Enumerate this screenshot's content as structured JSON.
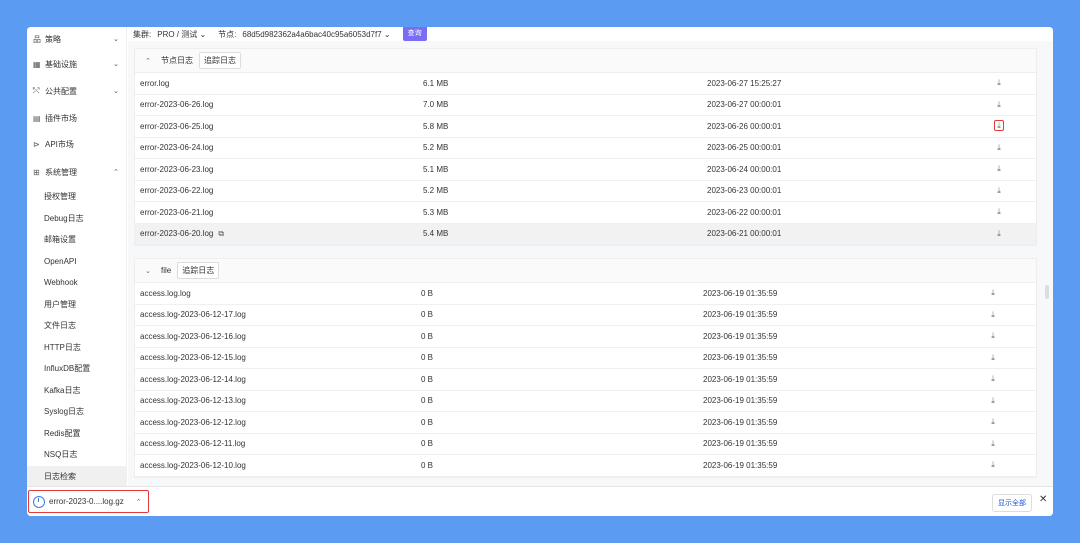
{
  "sidebar": {
    "items": [
      {
        "icon": "strategy-icon",
        "glyph": "品",
        "label": "策略",
        "chevron": "⌄"
      },
      {
        "icon": "grid-icon",
        "glyph": "▦",
        "label": "基础设施",
        "chevron": "⌄"
      },
      {
        "icon": "share-icon",
        "glyph": "⤲",
        "label": "公共配置",
        "chevron": "⌄"
      },
      {
        "icon": "store-icon",
        "glyph": "▤",
        "label": "插件市场",
        "chevron": ""
      },
      {
        "icon": "api-icon",
        "glyph": "⊳",
        "label": "API市场",
        "chevron": ""
      },
      {
        "icon": "apps-icon",
        "glyph": "⊞",
        "label": "系统管理",
        "chevron": "⌃"
      }
    ],
    "sub_items": [
      "授权管理",
      "Debug日志",
      "邮箱设置",
      "OpenAPI",
      "Webhook",
      "用户管理",
      "文件日志",
      "HTTP日志",
      "InfluxDB配置",
      "Kafka日志",
      "Syslog日志",
      "Redis配置",
      "NSQ日志",
      "日志检索"
    ]
  },
  "topbar": {
    "cluster_label": "集群:",
    "cluster_value": "PRO / 测试 ⌄",
    "node_label": "节点:",
    "node_value": "68d5d982362a4a6bac40c95a6053d7f7 ⌄",
    "query_button": "查询"
  },
  "panel1": {
    "title": "节点日志",
    "track_button": "追踪日志",
    "rows": [
      {
        "name": "error.log",
        "size": "6.1 MB",
        "time": "2023-06-27 15:25:27"
      },
      {
        "name": "error-2023-06-26.log",
        "size": "7.0 MB",
        "time": "2023-06-27 00:00:01"
      },
      {
        "name": "error-2023-06-25.log",
        "size": "5.8 MB",
        "time": "2023-06-26 00:00:01"
      },
      {
        "name": "error-2023-06-24.log",
        "size": "5.2 MB",
        "time": "2023-06-25 00:00:01"
      },
      {
        "name": "error-2023-06-23.log",
        "size": "5.1 MB",
        "time": "2023-06-24 00:00:01"
      },
      {
        "name": "error-2023-06-22.log",
        "size": "5.2 MB",
        "time": "2023-06-23 00:00:01"
      },
      {
        "name": "error-2023-06-21.log",
        "size": "5.3 MB",
        "time": "2023-06-22 00:00:01"
      },
      {
        "name": "error-2023-06-20.log",
        "size": "5.4 MB",
        "time": "2023-06-21 00:00:01"
      }
    ]
  },
  "panel2": {
    "title": "file",
    "track_button": "追踪日志",
    "rows": [
      {
        "name": "access.log.log",
        "size": "0 B",
        "time": "2023-06-19 01:35:59"
      },
      {
        "name": "access.log-2023-06-12-17.log",
        "size": "0 B",
        "time": "2023-06-19 01:35:59"
      },
      {
        "name": "access.log-2023-06-12-16.log",
        "size": "0 B",
        "time": "2023-06-19 01:35:59"
      },
      {
        "name": "access.log-2023-06-12-15.log",
        "size": "0 B",
        "time": "2023-06-19 01:35:59"
      },
      {
        "name": "access.log-2023-06-12-14.log",
        "size": "0 B",
        "time": "2023-06-19 01:35:59"
      },
      {
        "name": "access.log-2023-06-12-13.log",
        "size": "0 B",
        "time": "2023-06-19 01:35:59"
      },
      {
        "name": "access.log-2023-06-12-12.log",
        "size": "0 B",
        "time": "2023-06-19 01:35:59"
      },
      {
        "name": "access.log-2023-06-12-11.log",
        "size": "0 B",
        "time": "2023-06-19 01:35:59"
      },
      {
        "name": "access.log-2023-06-12-10.log",
        "size": "0 B",
        "time": "2023-06-19 01:35:59"
      }
    ]
  },
  "download_bar": {
    "file_name": "error-2023-0....log.gz",
    "show_all": "显示全部",
    "close": "✕"
  },
  "colors": {
    "background": "#5b9cf2",
    "accent": "#7b6cf6",
    "highlight_box": "#e23b3b"
  }
}
